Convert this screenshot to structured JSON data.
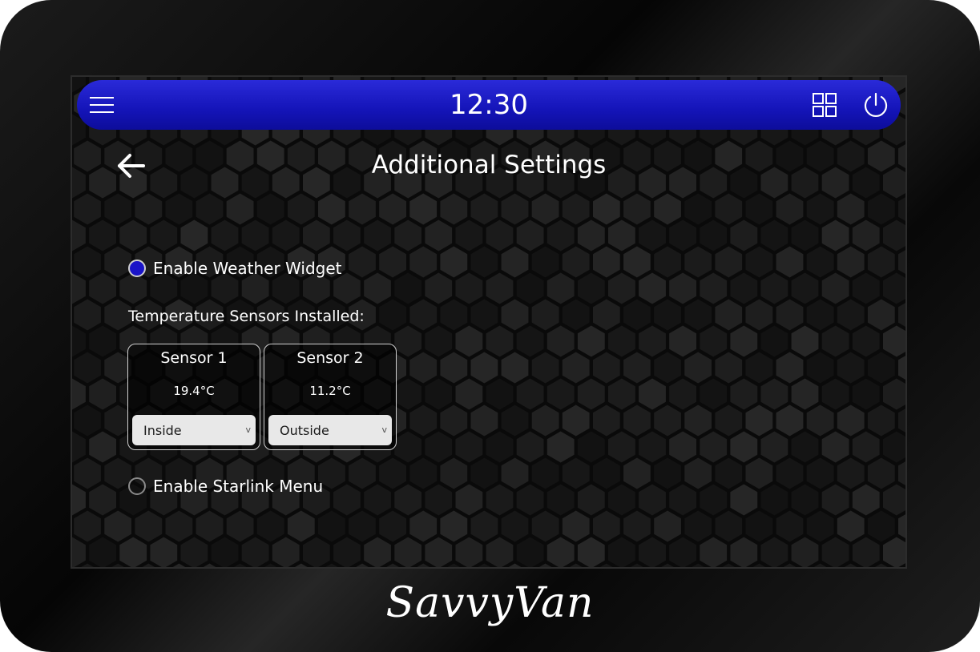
{
  "topbar": {
    "time": "12:30",
    "menu_icon": "menu-icon",
    "apps_icon": "grid-icon",
    "power_icon": "power-icon",
    "accent_color": "#1414b8"
  },
  "header": {
    "back_icon": "arrow-left-icon",
    "title": "Additional Settings"
  },
  "settings": {
    "weather_widget": {
      "label": "Enable Weather Widget",
      "checked": true
    },
    "sensors_label": "Temperature Sensors Installed:",
    "sensors": [
      {
        "name": "Sensor 1",
        "temperature": "19.4°C",
        "location": "Inside",
        "chevron": "v"
      },
      {
        "name": "Sensor 2",
        "temperature": "11.2°C",
        "location": "Outside",
        "chevron": "v"
      }
    ],
    "starlink_menu": {
      "label": "Enable Starlink Menu",
      "checked": false
    }
  },
  "brand": {
    "logo_text": "SavvyVan"
  }
}
